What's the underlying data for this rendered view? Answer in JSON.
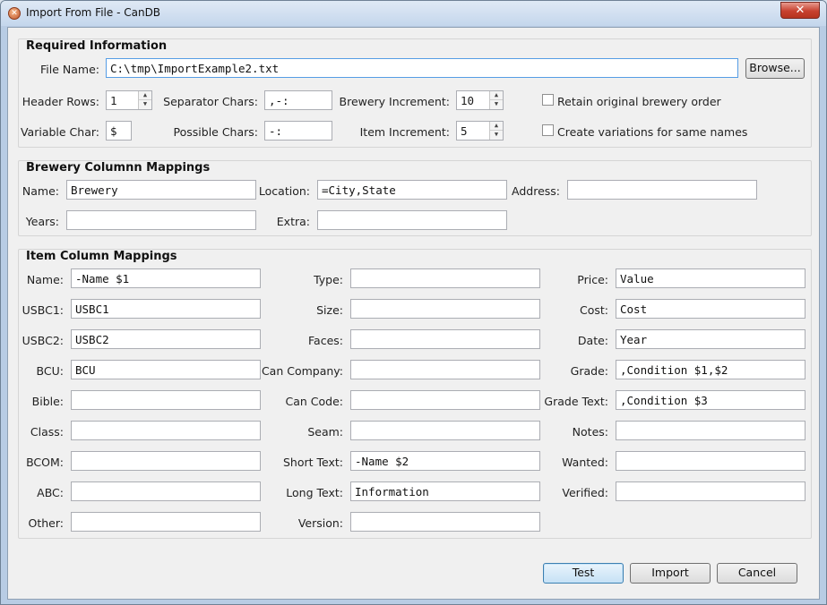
{
  "window": {
    "title": "Import From File - CanDB",
    "app_icon": "candb-app-icon",
    "close_glyph": "✕"
  },
  "required": {
    "title": "Required Information",
    "file_name_label": "File Name:",
    "file_name_value": "C:\\tmp\\ImportExample2.txt",
    "browse_label": "Browse...",
    "header_rows_label": "Header Rows:",
    "header_rows_value": "1",
    "separator_chars_label": "Separator Chars:",
    "separator_chars_value": ",-:",
    "brewery_increment_label": "Brewery Increment:",
    "brewery_increment_value": "10",
    "retain_order_label": "Retain original brewery order",
    "variable_char_label": "Variable Char:",
    "variable_char_value": "$",
    "possible_chars_label": "Possible Chars:",
    "possible_chars_value": "-:",
    "item_increment_label": "Item Increment:",
    "item_increment_value": "5",
    "create_variations_label": "Create variations for same names"
  },
  "brewery": {
    "title": "Brewery Columnn Mappings",
    "name_label": "Name:",
    "name_value": "Brewery",
    "location_label": "Location:",
    "location_value": "=City,State",
    "address_label": "Address:",
    "address_value": "",
    "years_label": "Years:",
    "years_value": "",
    "extra_label": "Extra:",
    "extra_value": ""
  },
  "item": {
    "title": "Item Column Mappings",
    "col1": [
      {
        "label": "Name:",
        "value": "-Name $1"
      },
      {
        "label": "USBC1:",
        "value": "USBC1"
      },
      {
        "label": "USBC2:",
        "value": "USBC2"
      },
      {
        "label": "BCU:",
        "value": "BCU"
      },
      {
        "label": "Bible:",
        "value": ""
      },
      {
        "label": "Class:",
        "value": ""
      },
      {
        "label": "BCOM:",
        "value": ""
      },
      {
        "label": "ABC:",
        "value": ""
      },
      {
        "label": "Other:",
        "value": ""
      }
    ],
    "col2": [
      {
        "label": "Type:",
        "value": ""
      },
      {
        "label": "Size:",
        "value": ""
      },
      {
        "label": "Faces:",
        "value": ""
      },
      {
        "label": "Can Company:",
        "value": ""
      },
      {
        "label": "Can Code:",
        "value": ""
      },
      {
        "label": "Seam:",
        "value": ""
      },
      {
        "label": "Short Text:",
        "value": "-Name $2"
      },
      {
        "label": "Long Text:",
        "value": "Information"
      },
      {
        "label": "Version:",
        "value": ""
      }
    ],
    "col3": [
      {
        "label": "Price:",
        "value": "Value"
      },
      {
        "label": "Cost:",
        "value": "Cost"
      },
      {
        "label": "Date:",
        "value": "Year"
      },
      {
        "label": "Grade:",
        "value": ",Condition $1,$2"
      },
      {
        "label": "Grade Text:",
        "value": ",Condition $3"
      },
      {
        "label": "Notes:",
        "value": ""
      },
      {
        "label": "Wanted:",
        "value": ""
      },
      {
        "label": "Verified:",
        "value": ""
      }
    ]
  },
  "footer": {
    "test_label": "Test",
    "import_label": "Import",
    "cancel_label": "Cancel"
  },
  "icons": {
    "spin_up": "▲",
    "spin_down": "▼"
  }
}
